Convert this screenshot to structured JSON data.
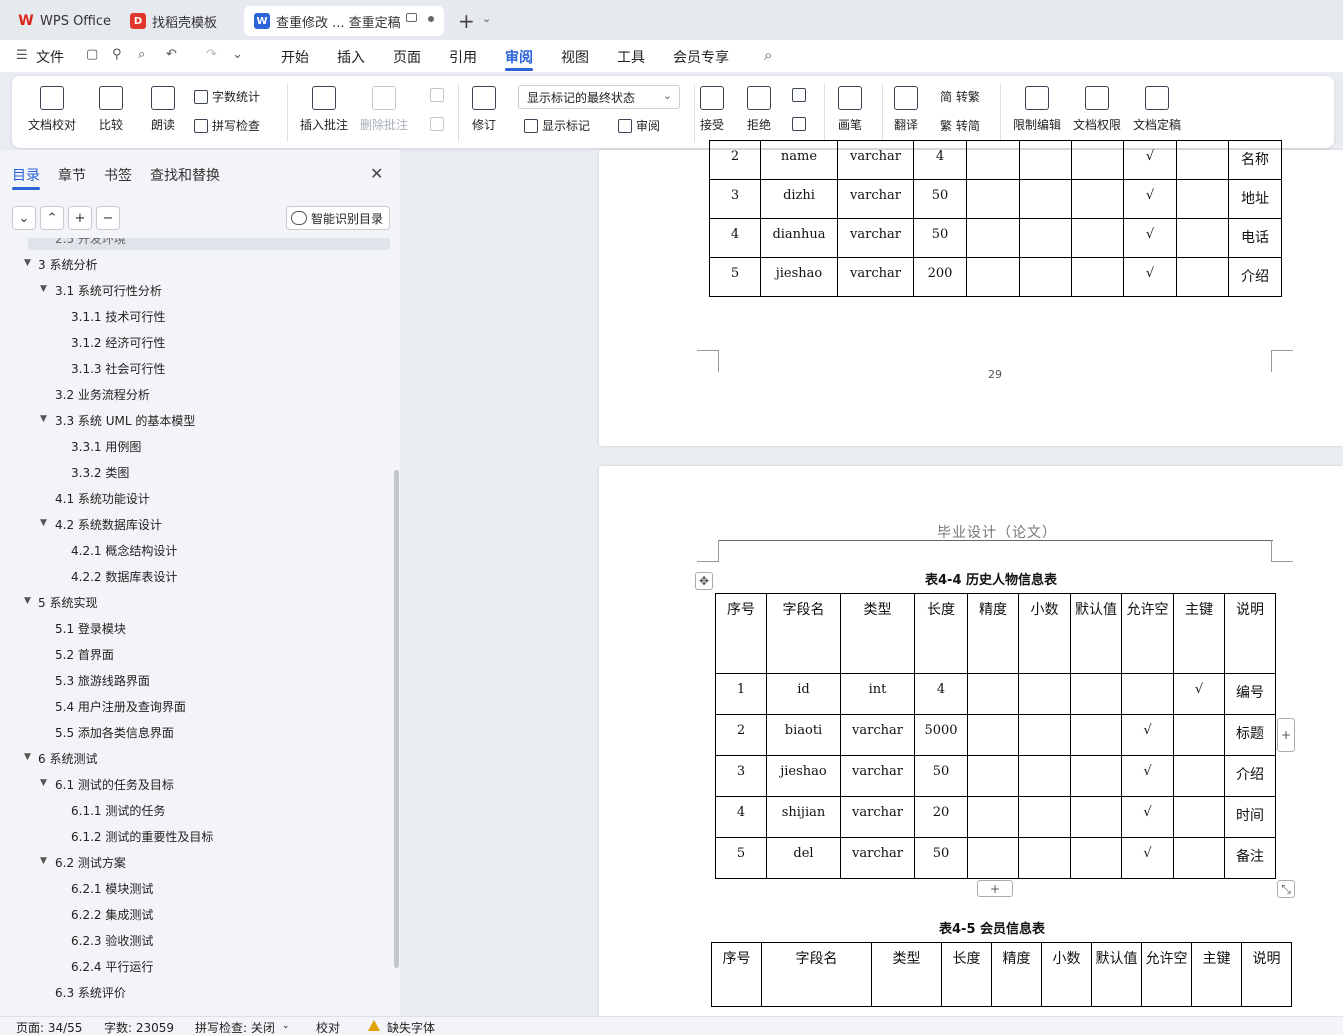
{
  "tabs": [
    {
      "label": "WPS Office",
      "icon": "wps-logo-icon"
    },
    {
      "label": "找稻壳模板",
      "icon": "docer-logo-icon"
    },
    {
      "label": "查重修改 ... 查重定稿",
      "icon": "word-doc-icon"
    }
  ],
  "menu": {
    "file": "文件",
    "items": [
      "开始",
      "插入",
      "页面",
      "引用",
      "审阅",
      "视图",
      "工具",
      "会员专享"
    ],
    "active": "审阅"
  },
  "ribbon": {
    "doc_proofread": "文档校对",
    "compare": "比较",
    "read_aloud": "朗读",
    "word_count": "字数统计",
    "spell_check": "拼写检查",
    "insert_comment": "插入批注",
    "delete_comment": "删除批注",
    "revise": "修订",
    "markup_state": "显示标记的最终状态",
    "show_markup": "显示标记",
    "review": "审阅",
    "accept": "接受",
    "reject": "拒绝",
    "pen": "画笔",
    "translate": "翻译",
    "to_traditional": "简 转繁",
    "to_simplified": "繁 转简",
    "restrict_edit": "限制编辑",
    "doc_permission": "文档权限",
    "doc_finalize": "文档定稿"
  },
  "leftpanel": {
    "tabs": [
      "目录",
      "章节",
      "书签",
      "查找和替换"
    ],
    "smart_toc": "智能识别目录",
    "toc": [
      {
        "text": "2.5  开发环境",
        "level": 2,
        "hl": true
      },
      {
        "text": "3  系统分析",
        "level": 1,
        "arrow": true
      },
      {
        "text": "3.1  系统可行性分析",
        "level": 2,
        "arrow": true
      },
      {
        "text": "3.1.1  技术可行性",
        "level": 3
      },
      {
        "text": "3.1.2  经济可行性",
        "level": 3
      },
      {
        "text": "3.1.3  社会可行性",
        "level": 3
      },
      {
        "text": "3.2  业务流程分析",
        "level": 2
      },
      {
        "text": "3.3  系统 UML 的基本模型",
        "level": 2,
        "arrow": true
      },
      {
        "text": "3.3.1  用例图",
        "level": 3
      },
      {
        "text": "3.3.2  类图",
        "level": 3
      },
      {
        "text": "4.1  系统功能设计",
        "level": 2
      },
      {
        "text": "4.2  系统数据库设计",
        "level": 2,
        "arrow": true
      },
      {
        "text": "4.2.1  概念结构设计",
        "level": 3
      },
      {
        "text": "4.2.2  数据库表设计",
        "level": 3
      },
      {
        "text": "5  系统实现",
        "level": 1,
        "arrow": true
      },
      {
        "text": "5.1 登录模块",
        "level": 2
      },
      {
        "text": "5.2  首界面",
        "level": 2
      },
      {
        "text": "5.3  旅游线路界面",
        "level": 2
      },
      {
        "text": "5.4  用户注册及查询界面",
        "level": 2
      },
      {
        "text": "5.5  添加各类信息界面",
        "level": 2
      },
      {
        "text": "6  系统测试",
        "level": 1,
        "arrow": true
      },
      {
        "text": "6.1 测试的任务及目标",
        "level": 2,
        "arrow": true
      },
      {
        "text": "6.1.1 测试的任务",
        "level": 3
      },
      {
        "text": "6.1.2 测试的重要性及目标",
        "level": 3
      },
      {
        "text": "6.2 测试方案",
        "level": 2,
        "arrow": true
      },
      {
        "text": "6.2.1 模块测试",
        "level": 3
      },
      {
        "text": "6.2.2 集成测试",
        "level": 3
      },
      {
        "text": "6.2.3 验收测试",
        "level": 3
      },
      {
        "text": "6.2.4 平行运行",
        "level": 3
      },
      {
        "text": "6.3 系统评价",
        "level": 2
      }
    ]
  },
  "page1": {
    "rows": [
      [
        "2",
        "name",
        "varchar",
        "4",
        "",
        "",
        "",
        "√",
        "",
        "名称"
      ],
      [
        "3",
        "dizhi",
        "varchar",
        "50",
        "",
        "",
        "",
        "√",
        "",
        "地址"
      ],
      [
        "4",
        "dianhua",
        "varchar",
        "50",
        "",
        "",
        "",
        "√",
        "",
        "电话"
      ],
      [
        "5",
        "jieshao",
        "varchar",
        "200",
        "",
        "",
        "",
        "√",
        "",
        "介绍"
      ]
    ],
    "page_number": "29"
  },
  "page2": {
    "header": "毕业设计（论文）",
    "table1_title": "表4-4  历史人物信息表",
    "headers": [
      "序号",
      "字段名",
      "类型",
      "长度",
      "精度",
      "小数",
      "默认值",
      "允许空",
      "主键",
      "说明"
    ],
    "table1_rows": [
      [
        "1",
        "id",
        "int",
        "4",
        "",
        "",
        "",
        "",
        "√",
        "编号"
      ],
      [
        "2",
        "biaoti",
        "varchar",
        "5000",
        "",
        "",
        "",
        "√",
        "",
        "标题"
      ],
      [
        "3",
        "jieshao",
        "varchar",
        "50",
        "",
        "",
        "",
        "√",
        "",
        "介绍"
      ],
      [
        "4",
        "shijian",
        "varchar",
        "20",
        "",
        "",
        "",
        "√",
        "",
        "时间"
      ],
      [
        "5",
        "del",
        "varchar",
        "50",
        "",
        "",
        "",
        "√",
        "",
        "备注"
      ]
    ],
    "table2_title": "表4-5  会员信息表"
  },
  "status": {
    "page": "页面: 34/55",
    "words": "字数: 23059",
    "spell": "拼写检查: 关闭",
    "proof": "校对",
    "missing_font": "缺失字体"
  }
}
